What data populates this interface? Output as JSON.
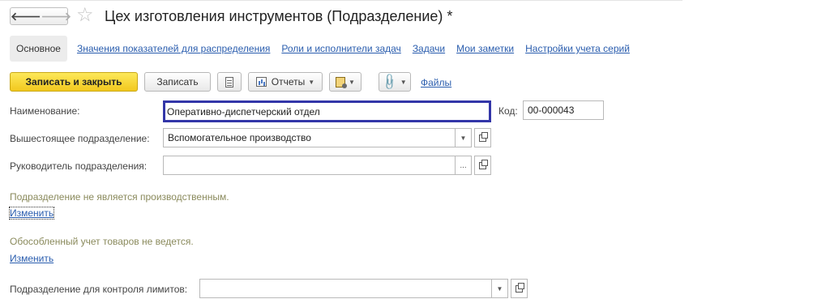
{
  "window": {
    "title": "Цех изготовления инструментов (Подразделение) *",
    "back_glyph": "🡐",
    "forward_glyph": "🡒",
    "star_glyph": "☆"
  },
  "tabs": {
    "active": "Основное",
    "links": [
      "Значения показателей для распределения",
      "Роли и исполнители задач",
      "Задачи",
      "Мои заметки",
      "Настройки учета серий"
    ]
  },
  "toolbar": {
    "save_close_label": "Записать и закрыть",
    "save_label": "Записать",
    "reports_label": "Отчеты",
    "files_label": "Файлы",
    "dropdown_glyph": "▼"
  },
  "form": {
    "name_label": "Наименование:",
    "name_value": "Оперативно-диспетчерский отдел",
    "code_label": "Код:",
    "code_value": "00-000043",
    "parent_label": "Вышестоящее подразделение:",
    "parent_value": "Вспомогательное производство",
    "head_label": "Руководитель подразделения:",
    "head_value": "",
    "production_info": "Подразделение не является производственным.",
    "production_change": "Изменить",
    "separate_info": "Обособленный учет товаров не ведется.",
    "separate_change": "Изменить",
    "limits_label": "Подразделение для контроля лимитов:",
    "limits_value": "",
    "dots_glyph": "...",
    "dropdown_glyph": "▼"
  },
  "colors": {
    "primary_button": "#f2c81e",
    "link": "#2a5dae",
    "focus_border": "#3336a8",
    "info_text": "#8a8a5c"
  }
}
